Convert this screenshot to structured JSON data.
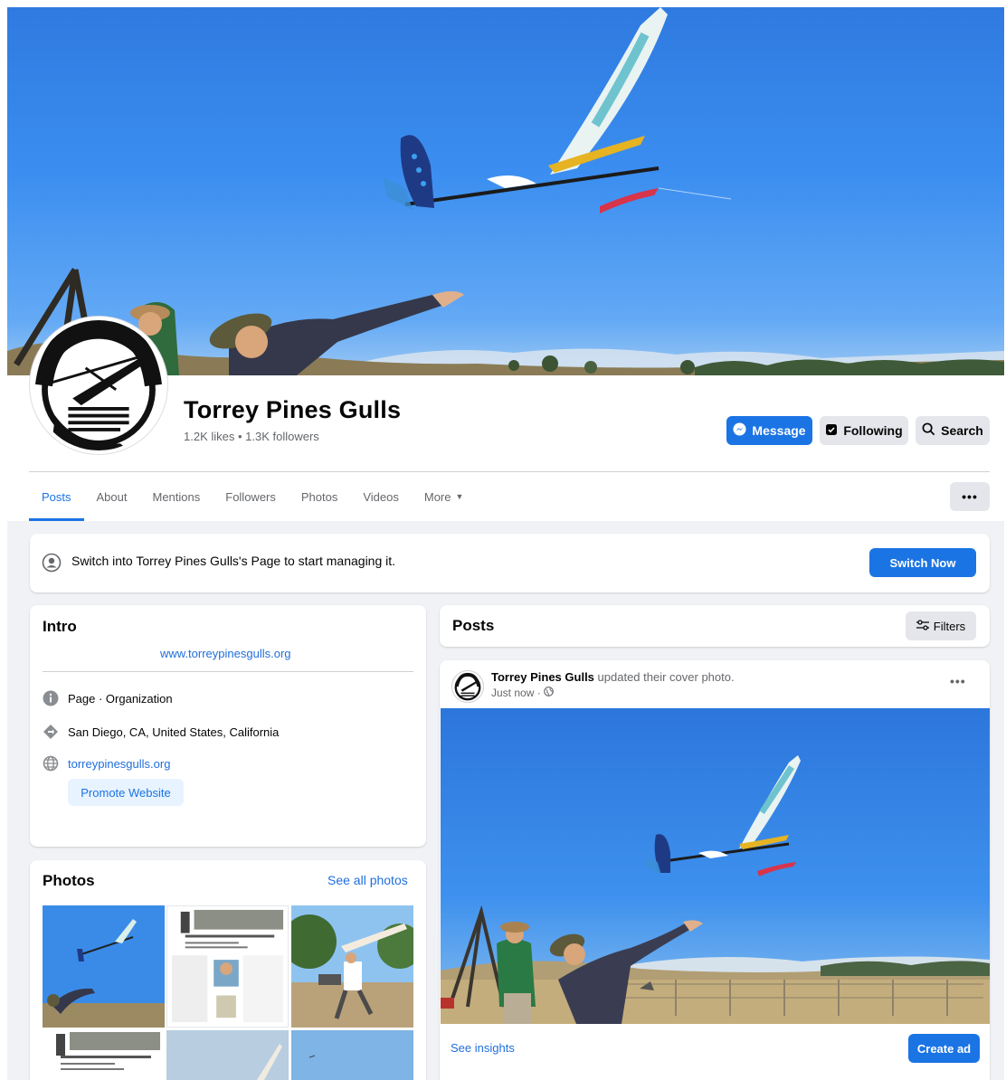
{
  "page": {
    "name": "Torrey Pines Gulls",
    "stats": "1.2K likes • 1.3K followers"
  },
  "actions": {
    "message": "Message",
    "following": "Following",
    "search": "Search",
    "more_menu": "•••"
  },
  "tabs": [
    {
      "label": "Posts",
      "active": true
    },
    {
      "label": "About",
      "active": false
    },
    {
      "label": "Mentions",
      "active": false
    },
    {
      "label": "Followers",
      "active": false
    },
    {
      "label": "Photos",
      "active": false
    },
    {
      "label": "Videos",
      "active": false
    },
    {
      "label": "More",
      "active": false
    }
  ],
  "switch_banner": {
    "text": "Switch into Torrey Pines Gulls's Page to start managing it.",
    "button": "Switch Now"
  },
  "intro": {
    "title": "Intro",
    "website_link": "www.torreypinesgulls.org",
    "category": "Page · Organization",
    "location": "San Diego, CA, United States, California",
    "website": "torreypinesgulls.org",
    "promote_button": "Promote Website"
  },
  "photos": {
    "title": "Photos",
    "see_all": "See all photos"
  },
  "posts": {
    "title": "Posts",
    "filters": "Filters",
    "post": {
      "author": "Torrey Pines Gulls",
      "action": " updated their cover photo.",
      "time": "Just now ·",
      "menu": "•••",
      "insights": "See insights",
      "create_ad": "Create ad"
    }
  },
  "colors": {
    "accent": "#1b74e4",
    "link": "#216fdb",
    "background": "#f0f2f5"
  },
  "icons": [
    "messenger-icon",
    "following-icon",
    "search-icon",
    "profile-switch-icon",
    "info-icon",
    "location-icon",
    "globe-icon",
    "filters-icon",
    "public-globe-icon"
  ]
}
